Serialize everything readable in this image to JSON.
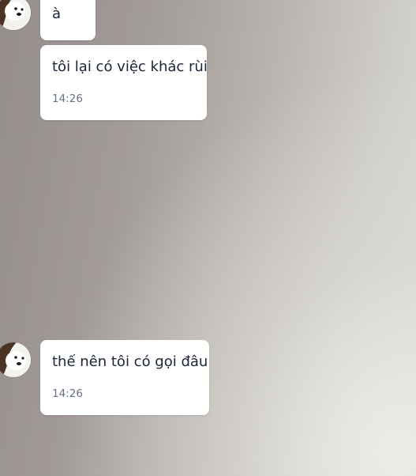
{
  "messages": [
    {
      "text": "à",
      "time": ""
    },
    {
      "text": "tôi lại có việc khác rùi",
      "time": "14:26"
    },
    {
      "text": "thế nên tôi có gọi đâu",
      "time": "14:26"
    }
  ],
  "icons": {
    "avatar": "bear-avatar-icon"
  },
  "colors": {
    "bubble": "#ffffff",
    "message_text": "#1b2536",
    "time_text": "#667086"
  }
}
